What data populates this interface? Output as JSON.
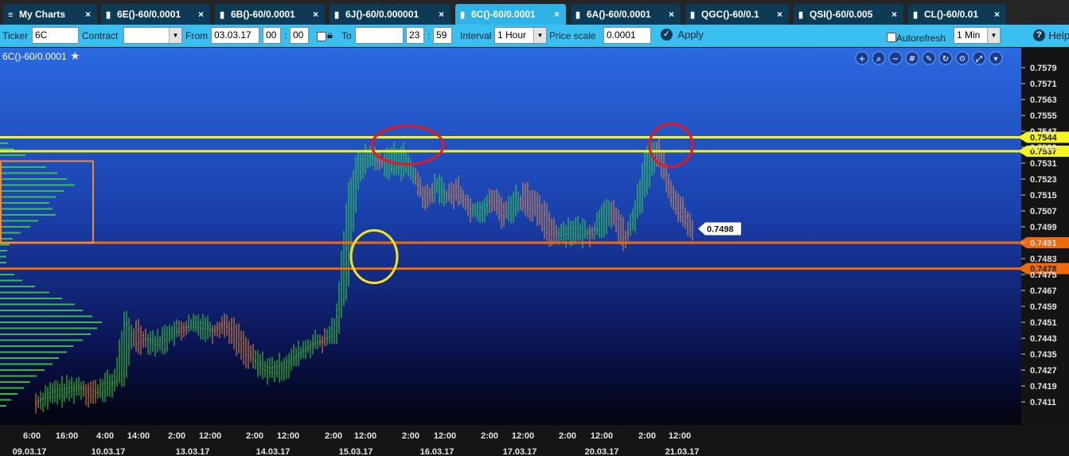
{
  "tabs": [
    {
      "label": "My Charts",
      "icon": "menu-icon",
      "active": false
    },
    {
      "label": "6E()-60/0.0001",
      "icon": "bar-chart-icon",
      "active": false
    },
    {
      "label": "6B()-60/0.0001",
      "icon": "bar-chart-icon",
      "active": false
    },
    {
      "label": "6J()-60/0.000001",
      "icon": "bar-chart-icon",
      "active": false
    },
    {
      "label": "6C()-60/0.0001",
      "icon": "bar-chart-icon",
      "active": true
    },
    {
      "label": "6A()-60/0.0001",
      "icon": "bar-chart-icon",
      "active": false
    },
    {
      "label": "QGC()-60/0.1",
      "icon": "bar-chart-icon",
      "active": false
    },
    {
      "label": "QSI()-60/0.005",
      "icon": "bar-chart-icon",
      "active": false
    },
    {
      "label": "CL()-60/0.01",
      "icon": "bar-chart-icon",
      "active": false
    }
  ],
  "close_glyph": "×",
  "toolbar": {
    "ticker_label": "Ticker",
    "ticker_value": "6C",
    "contract_label": "Contract",
    "contract_value": "",
    "from_label": "From",
    "from_date": "03.03.17",
    "from_hour": "00",
    "from_min": "00",
    "to_label": "To",
    "to_date": "",
    "to_hour": "23",
    "to_min": "59",
    "interval_label": "Interval",
    "interval_value": "1 Hour",
    "price_scale_label": "Price scale",
    "price_scale_value": "0.0001",
    "apply_label": "Apply",
    "autorefresh_label": "Autorefresh",
    "autorefresh_value": "1 Min",
    "help_label": "Help",
    "colon": ":"
  },
  "chart_title": "6C()-60/0.0001",
  "chart_icons": [
    "zoom-in-icon",
    "zoom-icon",
    "zoom-out-icon",
    "grid-icon",
    "pencil-icon",
    "refresh-icon",
    "settings-icon",
    "fullscreen-icon",
    "chevron-down-icon"
  ],
  "colors": {
    "accent": "#2fb2e6",
    "up": "#34e034",
    "down": "#f0903a",
    "resistance": "#f5f520",
    "support": "#f06a0c",
    "circle_red": "#e8181f",
    "circle_yellow": "#f5e51a",
    "box": "#f08a3c"
  },
  "chart_data": {
    "type": "ohlc",
    "ylim": [
      0.7405,
      0.7585
    ],
    "y_ticks": [
      "0.7579",
      "0.7571",
      "0.7563",
      "0.7555",
      "0.7547",
      "0.7539",
      "0.7531",
      "0.7523",
      "0.7515",
      "0.7507",
      "0.7499",
      "0.7491",
      "0.7483",
      "0.7475",
      "0.7467",
      "0.7459",
      "0.7451",
      "0.7443",
      "0.7435",
      "0.7427",
      "0.7419",
      "0.7411"
    ],
    "x_time_ticks": [
      "6:00",
      "16:00",
      "4:00",
      "14:00",
      "2:00",
      "12:00",
      "2:00",
      "12:00",
      "2:00",
      "12:00",
      "2:00",
      "12:00",
      "2:00",
      "12:00",
      "2:00",
      "12:00",
      "2:00",
      "12:00"
    ],
    "x_date_ticks": [
      "09.03.17",
      "10.03.17",
      "13.03.17",
      "14.03.17",
      "15.03.17",
      "16.03.17",
      "17.03.17",
      "20.03.17",
      "21.03.17"
    ],
    "levels": [
      {
        "value": 0.7544,
        "label": "0.7544",
        "kind": "resistance"
      },
      {
        "value": 0.7537,
        "label": "0.7537",
        "kind": "resistance"
      },
      {
        "value": 0.7491,
        "label": "0.7491",
        "kind": "support"
      },
      {
        "value": 0.7478,
        "label": "0.7478",
        "kind": "support"
      }
    ],
    "last_price": {
      "value": 0.7498,
      "label": "0.7498"
    },
    "price_path": [
      [
        0.7411,
        0.741
      ],
      [
        0.7413,
        0.7415
      ],
      [
        0.7414,
        0.7417
      ],
      [
        0.7416,
        0.7418
      ],
      [
        0.7418,
        0.7419
      ],
      [
        0.7417,
        0.7413
      ],
      [
        0.7415,
        0.742
      ],
      [
        0.742,
        0.7421
      ],
      [
        0.7426,
        0.7452
      ],
      [
        0.7449,
        0.744
      ],
      [
        0.7442,
        0.7443
      ],
      [
        0.7439,
        0.7441
      ],
      [
        0.7443,
        0.7447
      ],
      [
        0.7448,
        0.7446
      ],
      [
        0.7449,
        0.745
      ],
      [
        0.7448,
        0.7451
      ],
      [
        0.7447,
        0.7446
      ],
      [
        0.7451,
        0.745
      ],
      [
        0.7446,
        0.7441
      ],
      [
        0.7438,
        0.7434
      ],
      [
        0.7429,
        0.7431
      ],
      [
        0.7426,
        0.7428
      ],
      [
        0.7425,
        0.7429
      ],
      [
        0.7431,
        0.7433
      ],
      [
        0.7436,
        0.7437
      ],
      [
        0.744,
        0.7441
      ],
      [
        0.7442,
        0.7441
      ],
      [
        0.7446,
        0.7452
      ],
      [
        0.747,
        0.7515
      ],
      [
        0.7525,
        0.7532
      ],
      [
        0.7534,
        0.7535
      ],
      [
        0.7532,
        0.7531
      ],
      [
        0.7528,
        0.7535
      ],
      [
        0.7529,
        0.7536
      ],
      [
        0.7525,
        0.7525
      ],
      [
        0.7515,
        0.7509
      ],
      [
        0.7518,
        0.7521
      ],
      [
        0.7515,
        0.7514
      ],
      [
        0.7519,
        0.7515
      ],
      [
        0.7509,
        0.7508
      ],
      [
        0.7504,
        0.7509
      ],
      [
        0.7514,
        0.7512
      ],
      [
        0.7509,
        0.7503
      ],
      [
        0.7505,
        0.7515
      ],
      [
        0.7519,
        0.7509
      ],
      [
        0.751,
        0.7506
      ],
      [
        0.7504,
        0.7495
      ],
      [
        0.7494,
        0.7496
      ],
      [
        0.7496,
        0.7499
      ],
      [
        0.7494,
        0.7498
      ],
      [
        0.7497,
        0.7495
      ],
      [
        0.7498,
        0.751
      ],
      [
        0.7508,
        0.7501
      ],
      [
        0.7494,
        0.7491
      ],
      [
        0.7504,
        0.7512
      ],
      [
        0.7522,
        0.7538
      ],
      [
        0.7539,
        0.7534
      ],
      [
        0.7519,
        0.7513
      ],
      [
        0.751,
        0.7503
      ],
      [
        0.75,
        0.7497
      ]
    ],
    "profile": [
      {
        "y": 0.7544,
        "v": 6
      },
      {
        "y": 0.7541,
        "v": 10
      },
      {
        "y": 0.7538,
        "v": 18
      },
      {
        "y": 0.7535,
        "v": 32
      },
      {
        "y": 0.7532,
        "v": 48
      },
      {
        "y": 0.7529,
        "v": 58
      },
      {
        "y": 0.7526,
        "v": 72
      },
      {
        "y": 0.7523,
        "v": 84
      },
      {
        "y": 0.752,
        "v": 94
      },
      {
        "y": 0.7517,
        "v": 80
      },
      {
        "y": 0.7514,
        "v": 70
      },
      {
        "y": 0.7511,
        "v": 62
      },
      {
        "y": 0.7508,
        "v": 66
      },
      {
        "y": 0.7505,
        "v": 70
      },
      {
        "y": 0.7502,
        "v": 48
      },
      {
        "y": 0.7499,
        "v": 38
      },
      {
        "y": 0.7496,
        "v": 26
      },
      {
        "y": 0.7493,
        "v": 16
      },
      {
        "y": 0.749,
        "v": 12
      },
      {
        "y": 0.7487,
        "v": 9
      },
      {
        "y": 0.7484,
        "v": 8
      },
      {
        "y": 0.7481,
        "v": 8
      },
      {
        "y": 0.7478,
        "v": 10
      },
      {
        "y": 0.7475,
        "v": 18
      },
      {
        "y": 0.7472,
        "v": 28
      },
      {
        "y": 0.7469,
        "v": 44
      },
      {
        "y": 0.7466,
        "v": 62
      },
      {
        "y": 0.7463,
        "v": 78
      },
      {
        "y": 0.746,
        "v": 94
      },
      {
        "y": 0.7457,
        "v": 104
      },
      {
        "y": 0.7454,
        "v": 116
      },
      {
        "y": 0.7451,
        "v": 128
      },
      {
        "y": 0.7448,
        "v": 122
      },
      {
        "y": 0.7445,
        "v": 114
      },
      {
        "y": 0.7442,
        "v": 104
      },
      {
        "y": 0.7439,
        "v": 92
      },
      {
        "y": 0.7436,
        "v": 84
      },
      {
        "y": 0.7433,
        "v": 74
      },
      {
        "y": 0.743,
        "v": 66
      },
      {
        "y": 0.7427,
        "v": 56
      },
      {
        "y": 0.7424,
        "v": 46
      },
      {
        "y": 0.7421,
        "v": 38
      },
      {
        "y": 0.7418,
        "v": 30
      },
      {
        "y": 0.7415,
        "v": 22
      },
      {
        "y": 0.7412,
        "v": 14
      },
      {
        "y": 0.7409,
        "v": 8
      }
    ]
  }
}
